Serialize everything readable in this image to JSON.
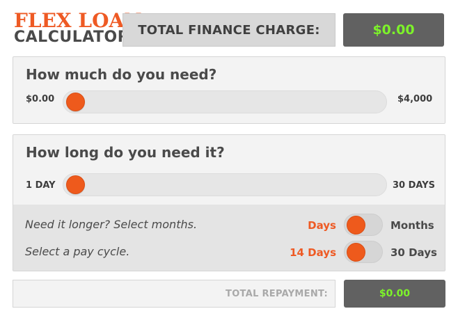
{
  "logo": {
    "line1": "FLEX LOAN",
    "line2": "CALCULATOR"
  },
  "header": {
    "finance_label": "TOTAL FINANCE CHARGE:",
    "finance_value": "$0.00"
  },
  "amount": {
    "title": "How much do you need?",
    "min_label": "$0.00",
    "max_label": "$4,000",
    "slider_fraction": 0.0
  },
  "term": {
    "title": "How long do you need it?",
    "min_label": "1 DAY",
    "max_label": "30 DAYS",
    "slider_fraction": 0.0,
    "options": [
      {
        "text": "Need it longer? Select months.",
        "left_label": "Days",
        "right_label": "Months",
        "selected": "left"
      },
      {
        "text": "Select a pay cycle.",
        "left_label": "14 Days",
        "right_label": "30 Days",
        "selected": "left"
      }
    ]
  },
  "footer": {
    "repayment_label": "TOTAL REPAYMENT:",
    "repayment_value": "$0.00"
  },
  "colors": {
    "accent": "#ee5a1c",
    "value_green": "#7df22a",
    "dark_box": "#616161"
  }
}
